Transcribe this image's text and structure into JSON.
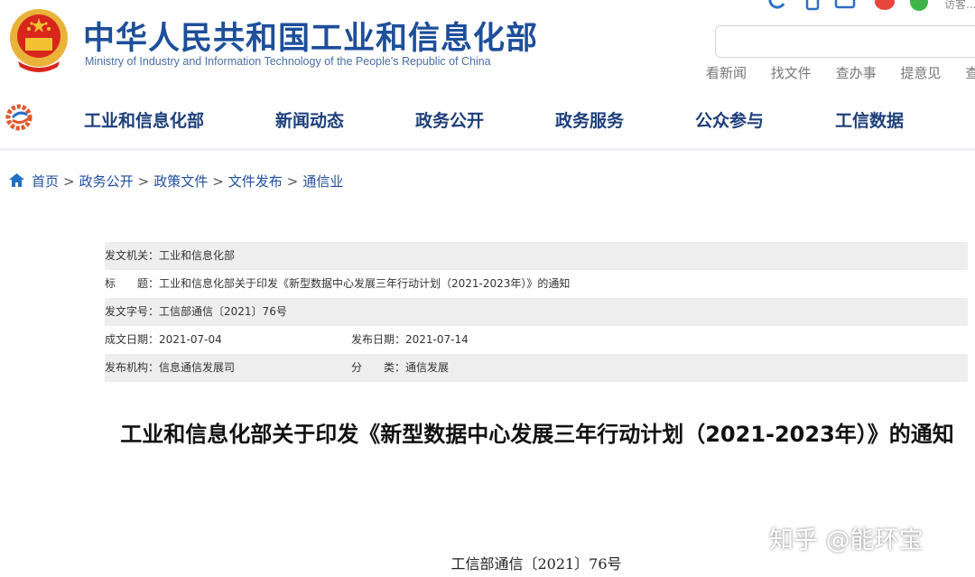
{
  "header": {
    "title": "中华人民共和国工业和信息化部",
    "subtitle": "Ministry of Industry and Information Technology of the People's Republic of China",
    "visit_text": "访客...",
    "quick_links": [
      "看新闻",
      "找文件",
      "查办事",
      "提意见",
      "查数"
    ]
  },
  "nav": {
    "items": [
      "工业和信息化部",
      "新闻动态",
      "政务公开",
      "政务服务",
      "公众参与",
      "工信数据"
    ]
  },
  "breadcrumb": [
    "首页",
    "政务公开",
    "政策文件",
    "文件发布",
    "通信业"
  ],
  "meta": {
    "issuer_label": "发文机关：",
    "issuer": "工业和信息化部",
    "title_label": "标　　题：",
    "title": "工业和信息化部关于印发《新型数据中心发展三年行动计划（2021-2023年）》的通知",
    "doc_no_label": "发文字号：",
    "doc_no": "工信部通信〔2021〕76号",
    "created_label": "成文日期：",
    "created": "2021-07-04",
    "published_label": "发布日期：",
    "published": "2021-07-14",
    "org_label": "发布机构：",
    "org": "信息通信发展司",
    "category_label": "分　　类：",
    "category": "通信发展"
  },
  "document": {
    "heading": "工业和信息化部关于印发《新型数据中心发展三年行动计划（2021-2023年）》的通知",
    "number": "工信部通信〔2021〕76号"
  },
  "watermark": "知乎 @能环宝",
  "colors": {
    "brand_blue": "#1d4f9a",
    "nav_text": "#1d3f7a",
    "emblem_red": "#d8261c",
    "gold": "#f2c232"
  }
}
